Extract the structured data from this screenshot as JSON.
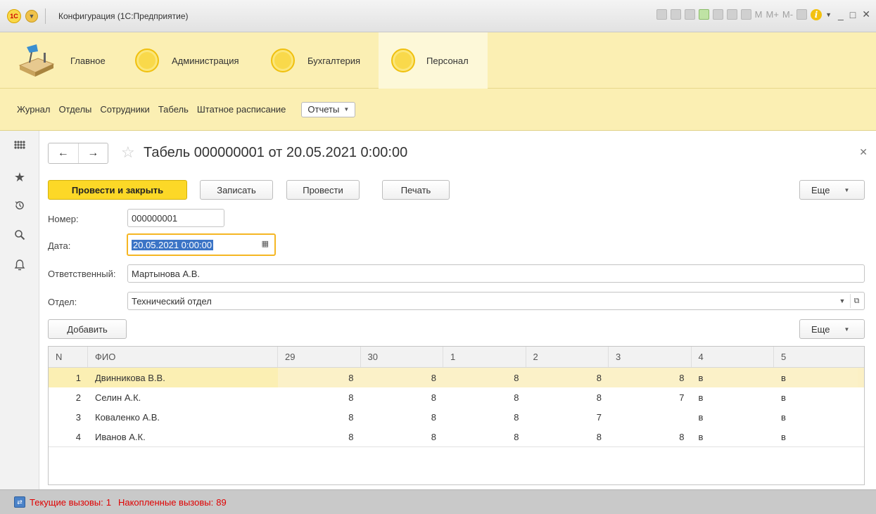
{
  "window": {
    "title": "Конфигурация (1С:Предприятие)",
    "logo_text": "1С",
    "toolbar_m": "M",
    "toolbar_mplus": "M+",
    "toolbar_mminus": "M-",
    "info_glyph": "i",
    "minimize": "_",
    "maximize": "□",
    "close": "✕"
  },
  "sections": [
    {
      "label": "Главное",
      "icon": "desk-lamp-icon"
    },
    {
      "label": "Администрация",
      "icon": "yellow-circle-icon"
    },
    {
      "label": "Бухгалтерия",
      "icon": "yellow-circle-icon"
    },
    {
      "label": "Персонал",
      "icon": "yellow-circle-icon",
      "active": true
    }
  ],
  "function_panel": {
    "items": [
      "Журнал",
      "Отделы",
      "Сотрудники",
      "Табель",
      "Штатное расписание"
    ],
    "reports_label": "Отчеты"
  },
  "form": {
    "title": "Табель 000000001 от 20.05.2021 0:00:00",
    "buttons": {
      "post_close": "Провести и закрыть",
      "save": "Записать",
      "post": "Провести",
      "print": "Печать",
      "more": "Еще"
    },
    "fields": {
      "number_label": "Номер:",
      "number_value": "000000001",
      "date_label": "Дата:",
      "date_value": "20.05.2021  0:00:00",
      "responsible_label": "Ответственный:",
      "responsible_value": "Мартынова А.В.",
      "department_label": "Отдел:",
      "department_value": "Технический отдел"
    },
    "table_toolbar": {
      "add": "Добавить",
      "more": "Еще"
    },
    "table": {
      "columns": [
        "N",
        "ФИО",
        "29",
        "30",
        "1",
        "2",
        "3",
        "4",
        "5"
      ],
      "rows": [
        [
          "1",
          "Двинникова В.В.",
          "8",
          "8",
          "8",
          "8",
          "8",
          "в",
          "в"
        ],
        [
          "2",
          "Селин А.К.",
          "8",
          "8",
          "8",
          "8",
          "7",
          "в",
          "в"
        ],
        [
          "3",
          "Коваленко А.В.",
          "8",
          "8",
          "8",
          "7",
          "",
          "в",
          "в"
        ],
        [
          "4",
          "Иванов А.К.",
          "8",
          "8",
          "8",
          "8",
          "8",
          "в",
          "в"
        ]
      ],
      "selected_row": 0
    }
  },
  "status_bar": {
    "current_calls_label": "Текущие вызовы:",
    "current_calls": "1",
    "accumulated_calls_label": "Накопленные вызовы:",
    "accumulated_calls": "89"
  },
  "colors": {
    "accent_yellow": "#fcd827",
    "panel_yellow": "#fbefb3",
    "focus_border": "#f5b623",
    "status_text": "#e00000"
  }
}
